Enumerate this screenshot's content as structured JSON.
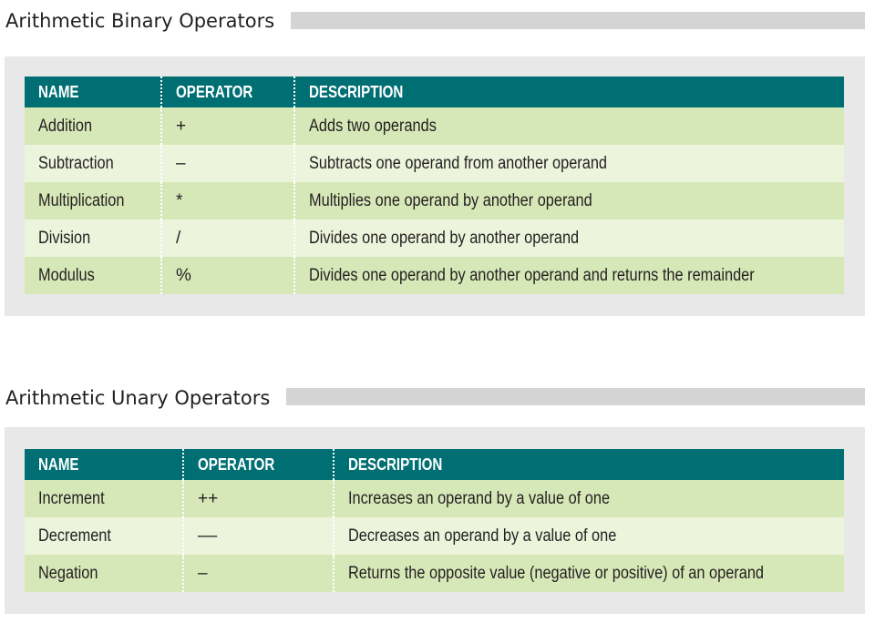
{
  "binary": {
    "title": "Arithmetic Binary Operators",
    "headers": {
      "name": "NAME",
      "operator": "OPERATOR",
      "description": "DESCRIPTION"
    },
    "rows": [
      {
        "name": "Addition",
        "operator": "+",
        "description": "Adds two operands"
      },
      {
        "name": "Subtraction",
        "operator": "–",
        "description": "Subtracts one operand from another operand"
      },
      {
        "name": "Multiplication",
        "operator": "*",
        "description": "Multiplies one operand by another operand"
      },
      {
        "name": "Division",
        "operator": "/",
        "description": "Divides one operand by another operand"
      },
      {
        "name": "Modulus",
        "operator": "%",
        "description": "Divides one operand by another operand and returns the remainder"
      }
    ]
  },
  "unary": {
    "title": "Arithmetic Unary Operators",
    "headers": {
      "name": "NAME",
      "operator": "OPERATOR",
      "description": "DESCRIPTION"
    },
    "rows": [
      {
        "name": "Increment",
        "operator": "++",
        "description": "Increases an operand by a value of one"
      },
      {
        "name": "Decrement",
        "operator": "––",
        "description": "Decreases an operand by a value of one"
      },
      {
        "name": "Negation",
        "operator": "–",
        "description": "Returns the opposite value (negative or positive) of an operand"
      }
    ]
  },
  "colors": {
    "header_bg": "#006f73",
    "row_dark": "#d7e8b8",
    "row_light": "#ecf4dc",
    "panel_bg": "#e8e8e8",
    "title_bar": "#d4d4d5"
  }
}
